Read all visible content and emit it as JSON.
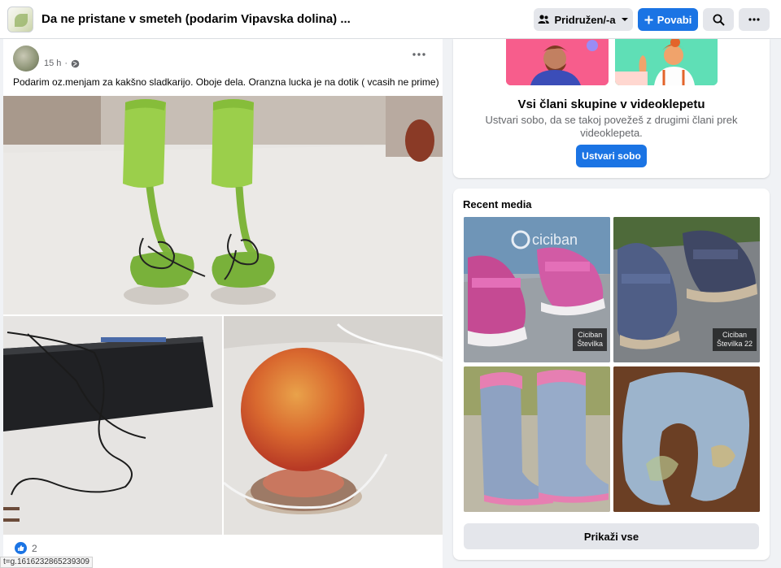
{
  "header": {
    "group_title": "Da ne pristane v smeteh (podarim Vipavska dolina) ...",
    "join_label": "Pridružen/-a",
    "invite_label": "Povabi"
  },
  "post": {
    "time": "15 h",
    "text": "Podarim oz.menjam za kakšno sladkarijo. Oboje dela. Oranzna lucka je na dotik ( vcasih ne prime)",
    "reaction_count": "2",
    "status_url": "t=g.1616232865239309"
  },
  "video_card": {
    "title": "Vsi člani skupine v videoklepetu",
    "description": "Ustvari sobo, da se takoj povežeš z drugimi člani prek videoklepeta.",
    "button_label": "Ustvari sobo"
  },
  "recent_media": {
    "title": "Recent media",
    "show_all_label": "Prikaži vse",
    "thumb1_label": "Ciciban\nŠtevilka",
    "thumb1_brand": "ciciban",
    "thumb2_label": "Ciciban\nŠtevilka 22"
  },
  "colors": {
    "primary": "#1b74e4",
    "secondary_button": "#e4e6eb",
    "page_background": "#f0f2f5"
  },
  "icons": [
    "chevron-down-icon",
    "plus-icon",
    "search-icon",
    "more-icon",
    "globe-icon",
    "like-icon"
  ]
}
